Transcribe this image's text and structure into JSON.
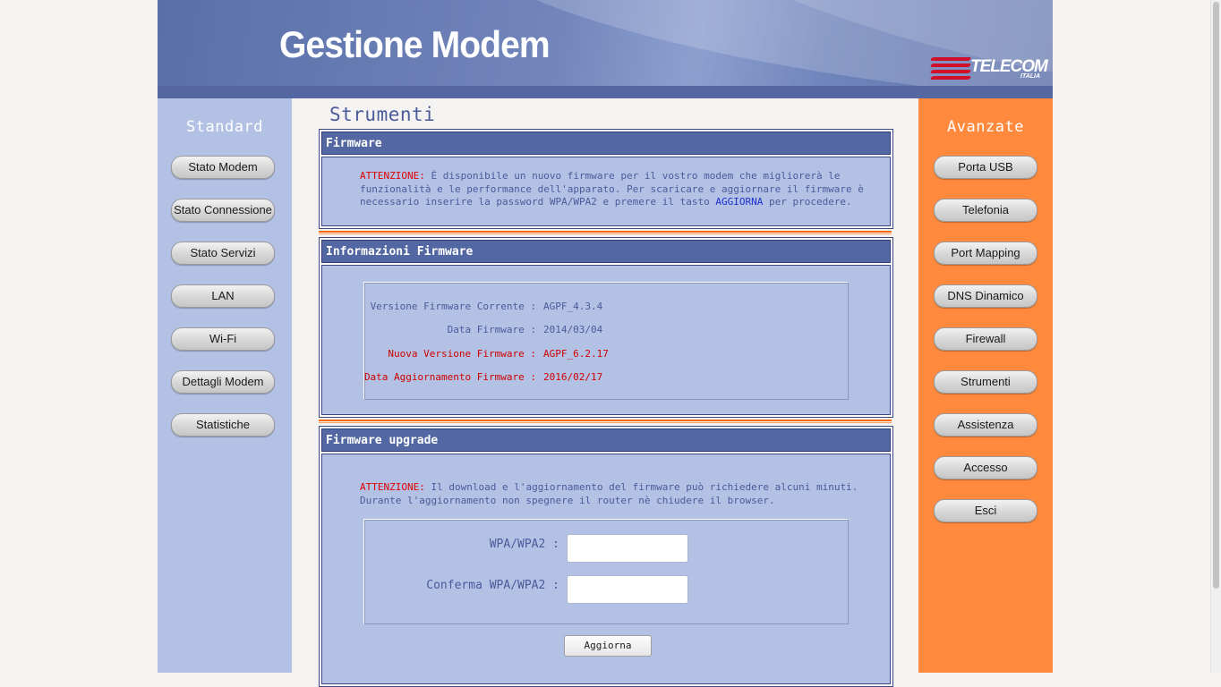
{
  "header": {
    "title": "Gestione Modem",
    "logo_name": "TELECOM",
    "logo_sub": "ITALIA"
  },
  "left_nav": {
    "title": "Standard",
    "items": [
      "Stato Modem",
      "Stato Connessione",
      "Stato Servizi",
      "LAN",
      "Wi-Fi",
      "Dettagli Modem",
      "Statistiche"
    ]
  },
  "right_nav": {
    "title": "Avanzate",
    "items": [
      "Porta USB",
      "Telefonia",
      "Port Mapping",
      "DNS Dinamico",
      "Firewall",
      "Strumenti",
      "Assistenza",
      "Accesso",
      "Esci"
    ]
  },
  "main": {
    "page_title": "Strumenti",
    "firmware": {
      "header": "Firmware",
      "attention": "ATTENZIONE:",
      "line1": " È disponibile un nuovo firmware per il vostro modem che migliorerà le",
      "line2": "funzionalità e le performance dell'apparato. Per scaricare e aggiornare il firmware è",
      "line3_a": "necessario inserire la password WPA/WPA2 e premere il tasto ",
      "line3_link": "AGGIORNA",
      "line3_b": " per procedere."
    },
    "info": {
      "header": "Informazioni Firmware",
      "rows": [
        {
          "label": "Versione Firmware Corrente :",
          "value": "AGPF_4.3.4"
        },
        {
          "label": "Data Firmware :",
          "value": "2014/03/04"
        },
        {
          "label": "Nuova Versione Firmware :",
          "value": "AGPF_6.2.17"
        },
        {
          "label": "Data Aggiornamento Firmware :",
          "value": "2016/02/17"
        }
      ]
    },
    "upgrade": {
      "header": "Firmware upgrade",
      "attention": "ATTENZIONE:",
      "line1": " Il download e l'aggiornamento del firmware può richiedere alcuni minuti.",
      "line2": "Durante l'aggiornamento non spegnere il router nè chiudere il browser.",
      "wpa_label": "WPA/WPA2 :",
      "wpa_value": "",
      "confirm_label": "Conferma WPA/WPA2 :",
      "confirm_value": "",
      "button": "Aggiorna"
    }
  },
  "colors": {
    "header": "#5a6ea8",
    "left_sidebar": "#b3c1e5",
    "right_sidebar": "#ff8a3d",
    "panel_header": "#5367a2",
    "alert": "#e00000"
  }
}
